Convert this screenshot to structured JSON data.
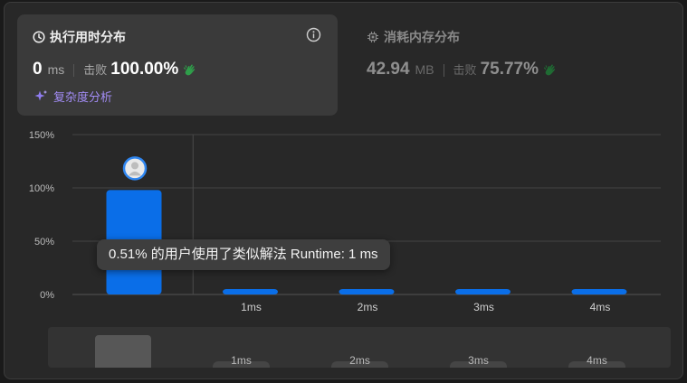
{
  "runtime": {
    "title": "执行用时分布",
    "value": "0",
    "unit": "ms",
    "beats_label": "击败",
    "beats_pct": "100.00%",
    "complexity_link": "复杂度分析"
  },
  "memory": {
    "title": "消耗内存分布",
    "value": "42.94",
    "unit": "MB",
    "beats_label": "击败",
    "beats_pct": "75.77%"
  },
  "tooltip": {
    "text": "0.51% 的用户使用了类似解法 Runtime: 1 ms"
  },
  "brush": {
    "labels": [
      "1ms",
      "2ms",
      "3ms",
      "4ms"
    ]
  },
  "colors": {
    "bar": "#0a6ee8",
    "accent_purple": "#a28cf5",
    "clap_green": "#2f9e4a"
  },
  "icons": {
    "runtime_title": "clock-icon",
    "memory_title": "chip-icon",
    "info": "info-icon",
    "beats": "clap-icon",
    "complexity": "sparkle-icon",
    "marker": "user-avatar-icon"
  },
  "chart_data": {
    "type": "bar",
    "categories": [
      "0ms",
      "1ms",
      "2ms",
      "3ms",
      "4ms"
    ],
    "tick_labels": [
      "",
      "1ms",
      "2ms",
      "3ms",
      "4ms"
    ],
    "values": [
      98,
      0.51,
      0.3,
      0.3,
      0.3
    ],
    "ylim": [
      0,
      150
    ],
    "yticks": [
      0,
      50,
      100,
      150
    ],
    "ytick_labels": [
      "0%",
      "50%",
      "100%",
      "150%"
    ],
    "grid": true,
    "marked_category": "0ms",
    "hover_category": "1ms"
  }
}
